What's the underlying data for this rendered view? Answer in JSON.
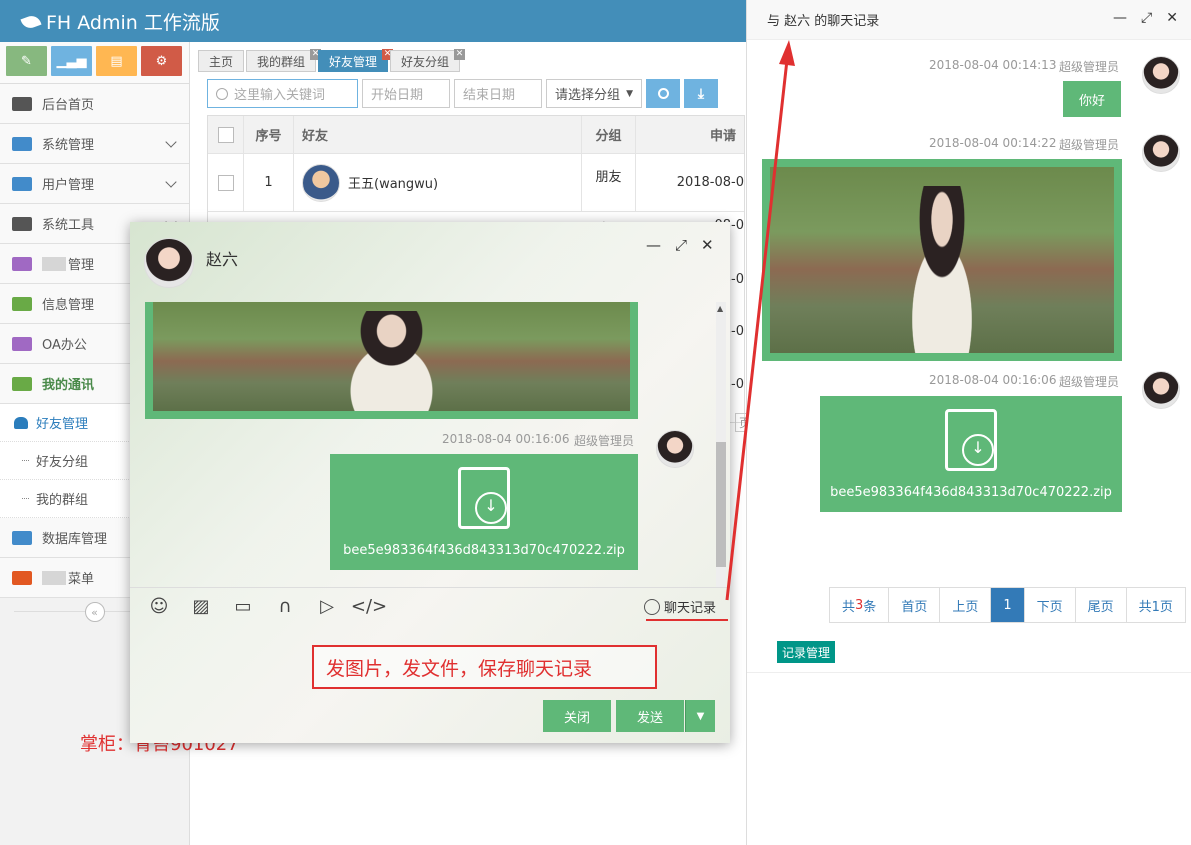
{
  "app": {
    "brand": "FH Admin 工作流版"
  },
  "sidebar": {
    "shortcut_colors": [
      "#87b87f",
      "#6fb3e0",
      "#ffb752",
      "#d15b47"
    ],
    "items": [
      {
        "label": "后台首页",
        "icon": "dashboard-icon",
        "color": "#555"
      },
      {
        "label": "系统管理",
        "icon": "home-icon",
        "color": "#428bca",
        "has_children": true
      },
      {
        "label": "用户管理",
        "icon": "users-icon",
        "color": "#428bca",
        "has_children": true
      },
      {
        "label": "系统工具",
        "icon": "gear-icon",
        "color": "#555",
        "has_children": true
      },
      {
        "label": "管理",
        "icon": "chat-icon",
        "color": "#a069c3",
        "redacted_prefix": true
      },
      {
        "label": "信息管理",
        "icon": "card-icon",
        "color": "#69aa46"
      },
      {
        "label": "OA办公",
        "icon": "laptop-icon",
        "color": "#a069c3"
      },
      {
        "label": "我的通讯",
        "icon": "comments-icon",
        "color": "#69aa46",
        "active_parent": true
      }
    ],
    "subitems": [
      {
        "label": "好友管理",
        "active": true
      },
      {
        "label": "好友分组"
      },
      {
        "label": "我的群组"
      }
    ],
    "items_after": [
      {
        "label": "数据库管理",
        "icon": "hdd-icon",
        "color": "#428bca"
      },
      {
        "label": "菜单",
        "icon": "fire-icon",
        "color": "#e25822",
        "redacted_prefix": true
      }
    ],
    "collapse": "«"
  },
  "watermark": "掌柜：青苔901027",
  "tabs": [
    {
      "label": "主页"
    },
    {
      "label": "我的群组",
      "closable": true
    },
    {
      "label": "好友管理",
      "closable": true,
      "active": true
    },
    {
      "label": "好友分组",
      "closable": true
    }
  ],
  "toolbar": {
    "search_placeholder": "这里输入关键词",
    "start_date": "开始日期",
    "end_date": "结束日期",
    "group_select": "请选择分组"
  },
  "grid": {
    "headers": [
      "序号",
      "好友",
      "分组",
      "申请"
    ],
    "rows": [
      {
        "no": "1",
        "name": "王五(wangwu)",
        "group": "朋友",
        "date": "2018-08-0"
      }
    ],
    "partial_cells": [
      "朋友",
      "08-0",
      "08-0",
      "08-0",
      "08-0",
      "页"
    ]
  },
  "chat": {
    "name": "赵六",
    "file_msg": {
      "time": "2018-08-04 00:16:06",
      "user": "超级管理员",
      "file": "bee5e983364f436d843313d70c470222.zip"
    },
    "history_link": "聊天记录",
    "annotation": "发图片，发文件，保存聊天记录",
    "close": "关闭",
    "send": "发送"
  },
  "panel": {
    "title": "与 赵六 的聊天记录",
    "messages": [
      {
        "time": "2018-08-04 00:14:13",
        "user": "超级管理员",
        "text": "你好"
      },
      {
        "time": "2018-08-04 00:14:22",
        "user": "超级管理员"
      },
      {
        "time": "2018-08-04 00:16:06",
        "user": "超级管理员",
        "file": "bee5e983364f436d843313d70c470222.zip"
      }
    ],
    "pager": {
      "total_prefix": "共",
      "total_count": "3",
      "total_suffix": "条",
      "first": "首页",
      "prev": "上页",
      "current": "1",
      "next": "下页",
      "last": "尾页",
      "pages": "共1页"
    },
    "record_button": "记录管理"
  }
}
